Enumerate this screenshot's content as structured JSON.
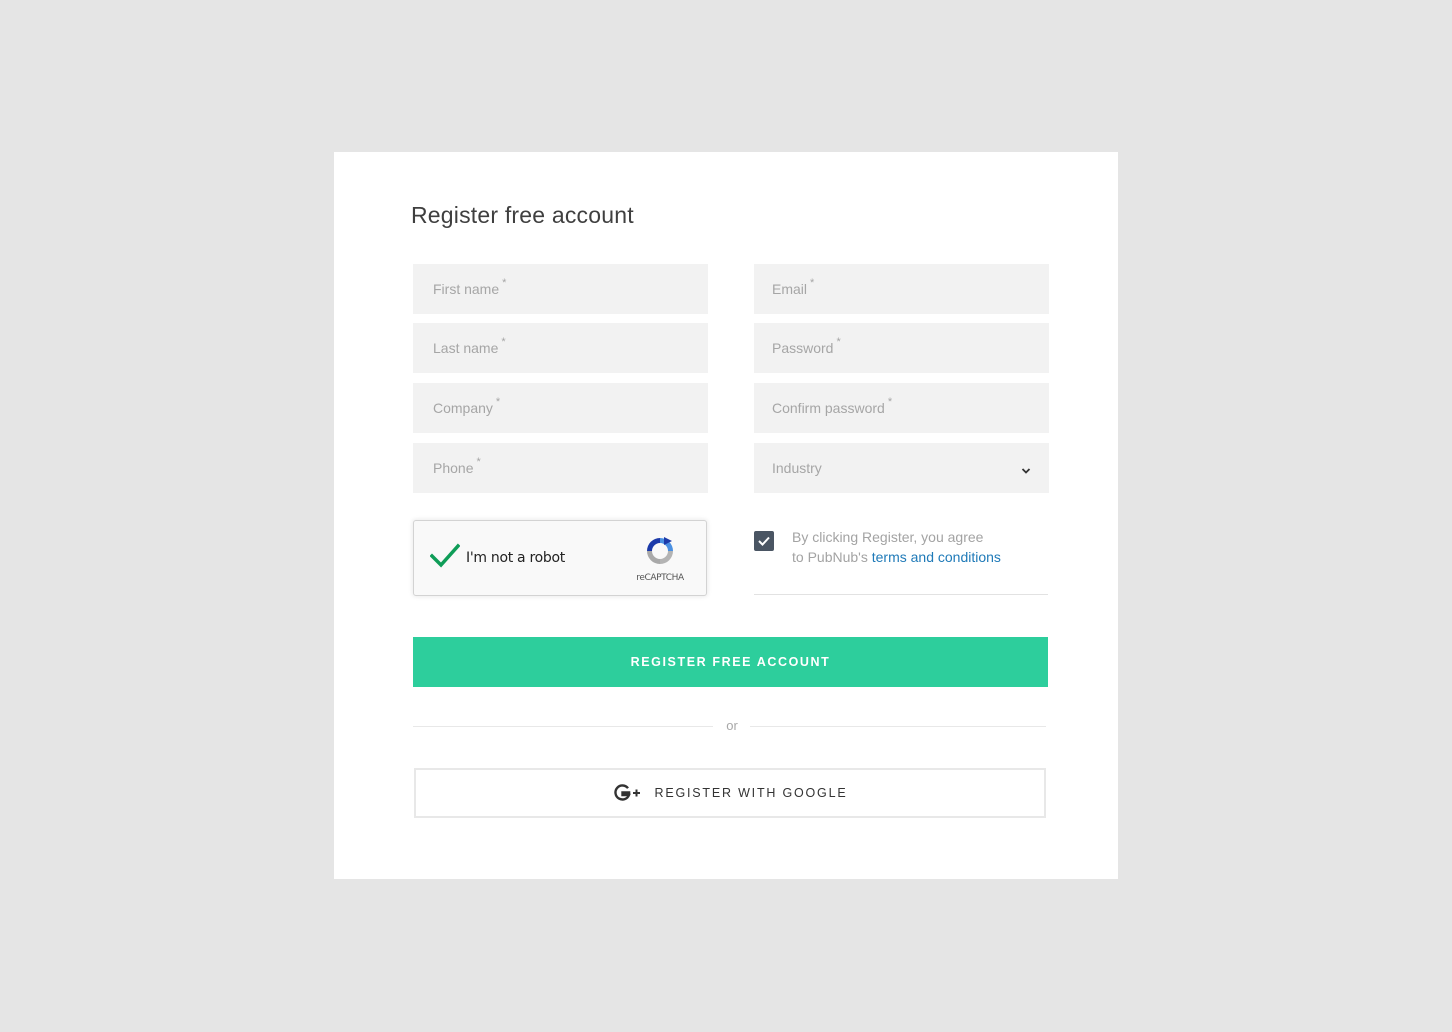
{
  "form": {
    "title": "Register free account",
    "fields": {
      "first_name": {
        "placeholder": "First name",
        "required": "*"
      },
      "last_name": {
        "placeholder": "Last name",
        "required": "*"
      },
      "company": {
        "placeholder": "Company",
        "required": "*"
      },
      "phone": {
        "placeholder": "Phone",
        "required": "*"
      },
      "email": {
        "placeholder": "Email",
        "required": "*"
      },
      "password": {
        "placeholder": "Password",
        "required": "*"
      },
      "confirm_password": {
        "placeholder": "Confirm password",
        "required": "*"
      },
      "industry": {
        "selected": "Industry"
      }
    },
    "captcha": {
      "label": "I'm not a robot",
      "brand": "reCAPTCHA",
      "checked": true
    },
    "agree": {
      "checked": true,
      "text_line1": "By clicking Register, you agree",
      "text_line2_prefix": "to PubNub's ",
      "link_text": "terms and conditions"
    },
    "submit_label": "REGISTER FREE ACCOUNT",
    "or_label": "or",
    "google_label": "REGISTER WITH GOOGLE",
    "icons": {
      "captcha_check": "checkmark-icon",
      "captcha_logo": "recaptcha-icon",
      "agree_check": "checkbox-check-icon",
      "industry_arrow": "chevron-down-icon",
      "google": "google-plus-icon"
    }
  },
  "colors": {
    "background": "#e5e5e5",
    "card": "#ffffff",
    "field_bg": "#f2f2f2",
    "primary": "#2dce9c",
    "link": "#1f7ab8",
    "checkbox": "#4a5563",
    "captcha_check": "#0f9d58"
  }
}
